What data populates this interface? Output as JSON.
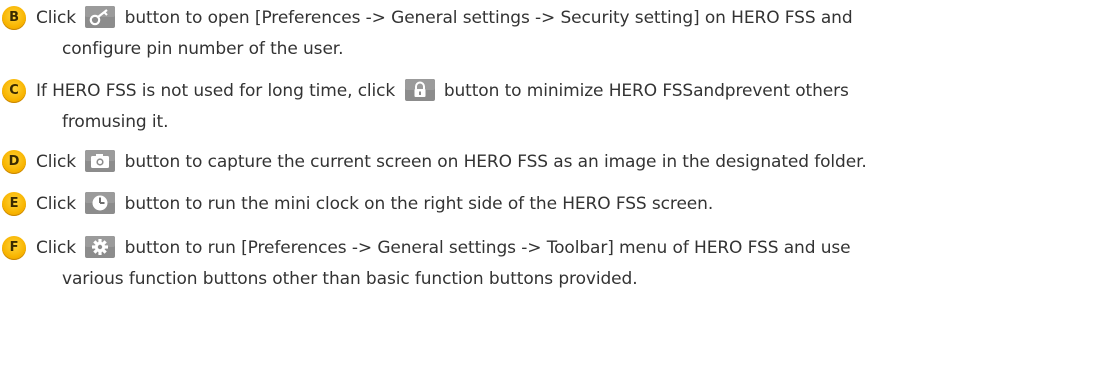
{
  "items": [
    {
      "letter": "B",
      "icon": "key-icon",
      "before": "Click",
      "after": "button to open [Preferences -> General settings -> Security setting] on HERO FSS and",
      "line2": "configure pin number of the user."
    },
    {
      "letter": "C",
      "icon": "lock-icon",
      "before": "If HERO FSS is not used for long time, click",
      "after": "button to minimize HERO FSSandprevent others",
      "line2": "fromusing it."
    },
    {
      "letter": "D",
      "icon": "camera-icon",
      "before": "Click",
      "after": "button to capture the current screen on HERO FSS as an image in the designated folder.",
      "line2": ""
    },
    {
      "letter": "E",
      "icon": "clock-icon",
      "before": "Click",
      "after": "button to run the mini clock on the right side of the HERO FSS screen.",
      "line2": ""
    },
    {
      "letter": "F",
      "icon": "gear-icon",
      "before": "Click",
      "after": "button to run [Preferences -> General settings -> Toolbar] menu of HERO FSS and use",
      "line2": "various function buttons other than basic function buttons provided."
    }
  ],
  "colors": {
    "badge": "#f8b400",
    "button_bg": "#8a8a8a",
    "text": "#333333"
  }
}
